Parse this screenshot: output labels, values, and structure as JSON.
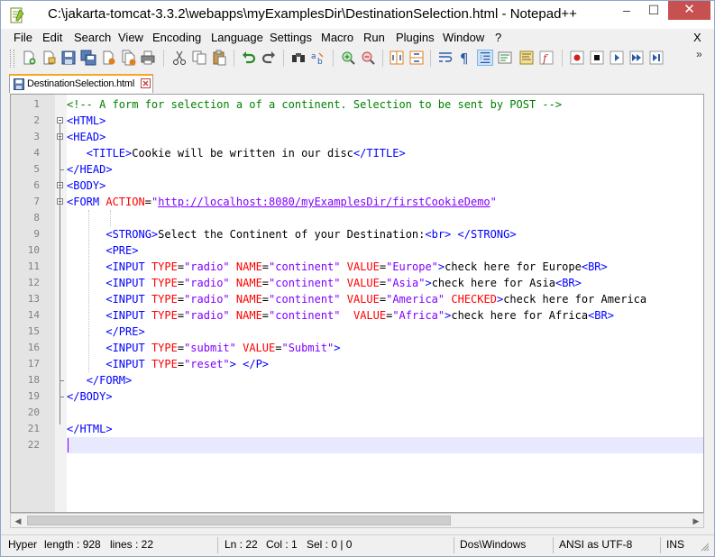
{
  "window": {
    "title": "C:\\jakarta-tomcat-3.3.2\\webapps\\myExamplesDir\\DestinationSelection.html - Notepad++",
    "minimize": "–",
    "maximize": "☐",
    "close": "✕"
  },
  "menu": {
    "items": [
      "File",
      "Edit",
      "Search",
      "View",
      "Encoding",
      "Language",
      "Settings",
      "Macro",
      "Run",
      "Plugins",
      "Window",
      "?"
    ],
    "close": "X"
  },
  "toolbar": {
    "overflow": "»"
  },
  "tab": {
    "label": "DestinationSelection.html"
  },
  "editor": {
    "line_numbers": [
      "1",
      "2",
      "3",
      "4",
      "5",
      "6",
      "7",
      "8",
      "9",
      "10",
      "11",
      "12",
      "13",
      "14",
      "15",
      "16",
      "17",
      "18",
      "19",
      "20",
      "21",
      "22"
    ],
    "lines": [
      [
        {
          "t": "<!-- A form for selection a of a continent. Selection to be sent by POST -->",
          "c": "c-comment"
        }
      ],
      [
        {
          "t": "<HTML>",
          "c": "c-tag"
        }
      ],
      [
        {
          "t": "<HEAD>",
          "c": "c-tag"
        }
      ],
      [
        {
          "t": "   ",
          "c": ""
        },
        {
          "t": "<TITLE>",
          "c": "c-tag"
        },
        {
          "t": "Cookie will be written in our disc",
          "c": ""
        },
        {
          "t": "</TITLE>",
          "c": "c-tag"
        }
      ],
      [
        {
          "t": "</HEAD>",
          "c": "c-tag"
        }
      ],
      [
        {
          "t": "<BODY>",
          "c": "c-tag"
        }
      ],
      [
        {
          "t": "<FORM ",
          "c": "c-tag"
        },
        {
          "t": "ACTION",
          "c": "c-attr"
        },
        {
          "t": "=",
          "c": "c-eq"
        },
        {
          "t": "\"",
          "c": "c-val"
        },
        {
          "t": "http://localhost:8080/myExamplesDir/firstCookieDemo",
          "c": "c-link"
        },
        {
          "t": "\"",
          "c": "c-val"
        }
      ],
      [],
      [
        {
          "t": "      ",
          "c": ""
        },
        {
          "t": "<STRONG>",
          "c": "c-tag"
        },
        {
          "t": "Select the Continent of your Destination:",
          "c": ""
        },
        {
          "t": "<br>",
          "c": "c-tag"
        },
        {
          "t": " ",
          "c": ""
        },
        {
          "t": "</STRONG>",
          "c": "c-tag"
        }
      ],
      [
        {
          "t": "      ",
          "c": ""
        },
        {
          "t": "<PRE>",
          "c": "c-tag"
        }
      ],
      [
        {
          "t": "      ",
          "c": ""
        },
        {
          "t": "<INPUT ",
          "c": "c-tag"
        },
        {
          "t": "TYPE",
          "c": "c-attr"
        },
        {
          "t": "=",
          "c": "c-eq"
        },
        {
          "t": "\"radio\"",
          "c": "c-val"
        },
        {
          "t": " ",
          "c": ""
        },
        {
          "t": "NAME",
          "c": "c-attr"
        },
        {
          "t": "=",
          "c": "c-eq"
        },
        {
          "t": "\"continent\"",
          "c": "c-val"
        },
        {
          "t": " ",
          "c": ""
        },
        {
          "t": "VALUE",
          "c": "c-attr"
        },
        {
          "t": "=",
          "c": "c-eq"
        },
        {
          "t": "\"Europe\"",
          "c": "c-val"
        },
        {
          "t": ">",
          "c": "c-tag"
        },
        {
          "t": "check here for Europe",
          "c": ""
        },
        {
          "t": "<BR>",
          "c": "c-tag"
        }
      ],
      [
        {
          "t": "      ",
          "c": ""
        },
        {
          "t": "<INPUT ",
          "c": "c-tag"
        },
        {
          "t": "TYPE",
          "c": "c-attr"
        },
        {
          "t": "=",
          "c": "c-eq"
        },
        {
          "t": "\"radio\"",
          "c": "c-val"
        },
        {
          "t": " ",
          "c": ""
        },
        {
          "t": "NAME",
          "c": "c-attr"
        },
        {
          "t": "=",
          "c": "c-eq"
        },
        {
          "t": "\"continent\"",
          "c": "c-val"
        },
        {
          "t": " ",
          "c": ""
        },
        {
          "t": "VALUE",
          "c": "c-attr"
        },
        {
          "t": "=",
          "c": "c-eq"
        },
        {
          "t": "\"Asia\"",
          "c": "c-val"
        },
        {
          "t": ">",
          "c": "c-tag"
        },
        {
          "t": "check here for Asia",
          "c": ""
        },
        {
          "t": "<BR>",
          "c": "c-tag"
        }
      ],
      [
        {
          "t": "      ",
          "c": ""
        },
        {
          "t": "<INPUT ",
          "c": "c-tag"
        },
        {
          "t": "TYPE",
          "c": "c-attr"
        },
        {
          "t": "=",
          "c": "c-eq"
        },
        {
          "t": "\"radio\"",
          "c": "c-val"
        },
        {
          "t": " ",
          "c": ""
        },
        {
          "t": "NAME",
          "c": "c-attr"
        },
        {
          "t": "=",
          "c": "c-eq"
        },
        {
          "t": "\"continent\"",
          "c": "c-val"
        },
        {
          "t": " ",
          "c": ""
        },
        {
          "t": "VALUE",
          "c": "c-attr"
        },
        {
          "t": "=",
          "c": "c-eq"
        },
        {
          "t": "\"America\"",
          "c": "c-val"
        },
        {
          "t": " ",
          "c": ""
        },
        {
          "t": "CHECKED",
          "c": "c-attr"
        },
        {
          "t": ">",
          "c": "c-tag"
        },
        {
          "t": "check here for America",
          "c": ""
        }
      ],
      [
        {
          "t": "      ",
          "c": ""
        },
        {
          "t": "<INPUT ",
          "c": "c-tag"
        },
        {
          "t": "TYPE",
          "c": "c-attr"
        },
        {
          "t": "=",
          "c": "c-eq"
        },
        {
          "t": "\"radio\"",
          "c": "c-val"
        },
        {
          "t": " ",
          "c": ""
        },
        {
          "t": "NAME",
          "c": "c-attr"
        },
        {
          "t": "=",
          "c": "c-eq"
        },
        {
          "t": "\"continent\"",
          "c": "c-val"
        },
        {
          "t": "  ",
          "c": ""
        },
        {
          "t": "VALUE",
          "c": "c-attr"
        },
        {
          "t": "=",
          "c": "c-eq"
        },
        {
          "t": "\"Africa\"",
          "c": "c-val"
        },
        {
          "t": ">",
          "c": "c-tag"
        },
        {
          "t": "check here for Africa",
          "c": ""
        },
        {
          "t": "<BR>",
          "c": "c-tag"
        }
      ],
      [
        {
          "t": "      ",
          "c": ""
        },
        {
          "t": "</PRE>",
          "c": "c-tag"
        }
      ],
      [
        {
          "t": "      ",
          "c": ""
        },
        {
          "t": "<INPUT ",
          "c": "c-tag"
        },
        {
          "t": "TYPE",
          "c": "c-attr"
        },
        {
          "t": "=",
          "c": "c-eq"
        },
        {
          "t": "\"submit\"",
          "c": "c-val"
        },
        {
          "t": " ",
          "c": ""
        },
        {
          "t": "VALUE",
          "c": "c-attr"
        },
        {
          "t": "=",
          "c": "c-eq"
        },
        {
          "t": "\"Submit\"",
          "c": "c-val"
        },
        {
          "t": ">",
          "c": "c-tag"
        }
      ],
      [
        {
          "t": "      ",
          "c": ""
        },
        {
          "t": "<INPUT ",
          "c": "c-tag"
        },
        {
          "t": "TYPE",
          "c": "c-attr"
        },
        {
          "t": "=",
          "c": "c-eq"
        },
        {
          "t": "\"reset\"",
          "c": "c-val"
        },
        {
          "t": ">",
          "c": "c-tag"
        },
        {
          "t": " ",
          "c": ""
        },
        {
          "t": "</P>",
          "c": "c-tag"
        }
      ],
      [
        {
          "t": "   ",
          "c": ""
        },
        {
          "t": "</FORM>",
          "c": "c-tag"
        }
      ],
      [
        {
          "t": "</BODY>",
          "c": "c-tag"
        }
      ],
      [],
      [
        {
          "t": "</HTML>",
          "c": "c-tag"
        }
      ],
      []
    ]
  },
  "status": {
    "type": "Hyper",
    "length": "length : 928",
    "lines": "lines : 22",
    "ln": "Ln : 22",
    "col": "Col : 1",
    "sel": "Sel : 0 | 0",
    "eol": "Dos\\Windows",
    "encoding": "ANSI as UTF-8",
    "mode": "INS"
  },
  "colors": {
    "comment": "#008000",
    "tag": "#0000ff",
    "attribute": "#ff0000",
    "value": "#8000ff",
    "current_line": "#e8e8ff",
    "tab_accent": "#f5a623"
  }
}
